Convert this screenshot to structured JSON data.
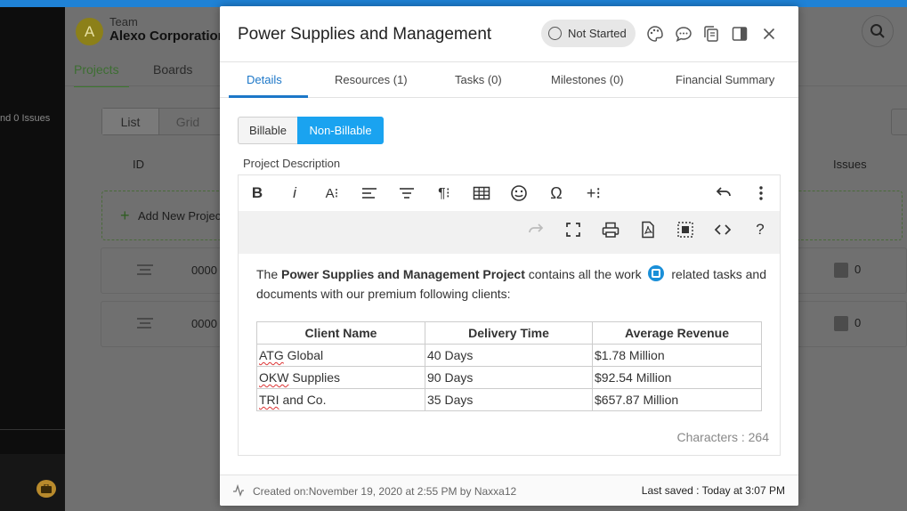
{
  "background": {
    "sidebar_text": "nd 0 Issues",
    "team": {
      "avatar_letter": "A",
      "label": "Team",
      "name": "Alexo Corporation"
    },
    "tabs": [
      "Projects",
      "Boards"
    ],
    "view_toggle": [
      "List",
      "Grid"
    ],
    "columns": {
      "id": "ID",
      "issues": "Issues"
    },
    "add_new_label": "Add New Project",
    "rows": [
      {
        "id": "0000",
        "issues": "0"
      },
      {
        "id": "0000",
        "issues": "0"
      }
    ]
  },
  "modal": {
    "title": "Power Supplies and Management",
    "status": "Not Started",
    "header_icons": [
      "palette-icon",
      "comment-icon",
      "copy-icon",
      "panel-icon",
      "close-icon"
    ],
    "tabs": [
      {
        "label": "Details",
        "active": true
      },
      {
        "label": "Resources (1)"
      },
      {
        "label": "Tasks (0)"
      },
      {
        "label": "Milestones (0)"
      },
      {
        "label": "Financial Summary"
      }
    ],
    "billing": {
      "billable": "Billable",
      "non_billable": "Non-Billable",
      "selected": "Non-Billable"
    },
    "description_label": "Project Description",
    "editor": {
      "toolbar_row1": [
        "bold",
        "italic",
        "font-size",
        "align",
        "paragraph-format",
        "paragraph",
        "table",
        "emoticons",
        "special-characters",
        "insert-more",
        "undo",
        "more"
      ],
      "toolbar_row2": [
        "redo",
        "fullscreen",
        "print",
        "pdf",
        "select-all",
        "code-view",
        "help"
      ],
      "text_before_bold": "The ",
      "text_bold": "Power Supplies and Management Project",
      "text_after_bold": " contains all the work ",
      "text_after_icon": " related tasks and documents with our premium following clients:",
      "table": {
        "headers": [
          "Client Name",
          "Delivery Time",
          "Average Revenue"
        ],
        "rows": [
          {
            "name_marked": "ATG",
            "name_rest": " Global",
            "delivery": "40 Days",
            "revenue": "$1.78 Million"
          },
          {
            "name_marked": "OKW",
            "name_rest": " Supplies",
            "delivery": "90 Days",
            "revenue": "$92.54 Million"
          },
          {
            "name_marked": "TRI",
            "name_rest": " and Co.",
            "delivery": "35 Days",
            "revenue": "$657.87 Million"
          }
        ]
      },
      "characters": "Characters : 264"
    },
    "footer": {
      "created": "Created on:November 19, 2020 at 2:55 PM by Naxxa12",
      "saved": "Last saved : Today at 3:07 PM"
    }
  },
  "colors": {
    "accent": "#1c77c8",
    "selected_button": "#1aa3f0",
    "top_strip": "#1f82d6"
  }
}
